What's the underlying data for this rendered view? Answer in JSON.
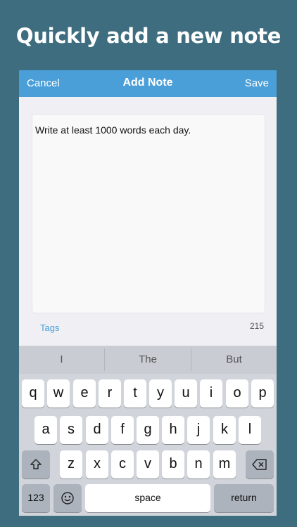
{
  "headline": "Quickly add a new note",
  "nav": {
    "cancel": "Cancel",
    "title": "Add Note",
    "save": "Save"
  },
  "editor": {
    "text": "Write at least 1000 words each day."
  },
  "footer": {
    "tags": "Tags",
    "count": "215"
  },
  "keyboard": {
    "suggestions": [
      "I",
      "The",
      "But"
    ],
    "row1": [
      "q",
      "w",
      "e",
      "r",
      "t",
      "y",
      "u",
      "i",
      "o",
      "p"
    ],
    "row2": [
      "a",
      "s",
      "d",
      "f",
      "g",
      "h",
      "j",
      "k",
      "l"
    ],
    "row3": [
      "z",
      "x",
      "c",
      "v",
      "b",
      "n",
      "m"
    ],
    "numbers": "123",
    "space": "space",
    "return": "return",
    "shift_icon": "shift-icon",
    "delete_icon": "delete-icon",
    "emoji_icon": "emoji-icon"
  }
}
